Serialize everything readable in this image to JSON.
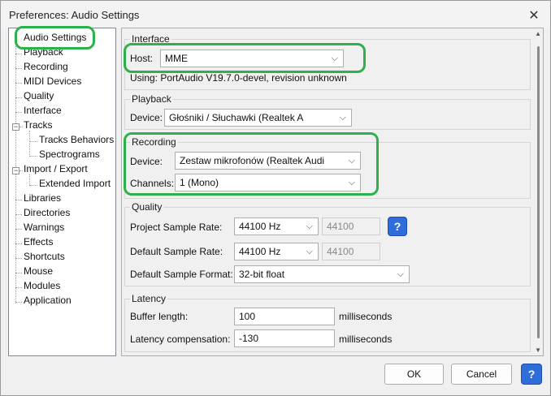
{
  "window": {
    "title": "Preferences: Audio Settings"
  },
  "tree": {
    "items": [
      {
        "label": "Audio Settings"
      },
      {
        "label": "Playback"
      },
      {
        "label": "Recording"
      },
      {
        "label": "MIDI Devices"
      },
      {
        "label": "Quality"
      },
      {
        "label": "Interface"
      },
      {
        "label": "Tracks"
      },
      {
        "label": "Tracks Behaviors"
      },
      {
        "label": "Spectrograms"
      },
      {
        "label": "Import / Export"
      },
      {
        "label": "Extended Import"
      },
      {
        "label": "Libraries"
      },
      {
        "label": "Directories"
      },
      {
        "label": "Warnings"
      },
      {
        "label": "Effects"
      },
      {
        "label": "Shortcuts"
      },
      {
        "label": "Mouse"
      },
      {
        "label": "Modules"
      },
      {
        "label": "Application"
      }
    ]
  },
  "interface": {
    "title": "Interface",
    "host_label": "Host:",
    "host_value": "MME",
    "using_text": "Using: PortAudio V19.7.0-devel, revision unknown"
  },
  "playback": {
    "title": "Playback",
    "device_label": "Device:",
    "device_value": "Głośniki / Słuchawki (Realtek A"
  },
  "recording": {
    "title": "Recording",
    "device_label": "Device:",
    "device_value": "Zestaw mikrofonów (Realtek Audi",
    "channels_label": "Channels:",
    "channels_value": "1 (Mono)"
  },
  "quality": {
    "title": "Quality",
    "project_rate_label": "Project Sample Rate:",
    "project_rate_value": "44100 Hz",
    "project_rate_text": "44100",
    "default_rate_label": "Default Sample Rate:",
    "default_rate_value": "44100 Hz",
    "default_rate_text": "44100",
    "default_format_label": "Default Sample Format:",
    "default_format_value": "32-bit float",
    "help_glyph": "?"
  },
  "latency": {
    "title": "Latency",
    "buffer_label": "Buffer length:",
    "buffer_value": "100",
    "buffer_unit": "milliseconds",
    "comp_label": "Latency compensation:",
    "comp_value": "-130",
    "comp_unit": "milliseconds"
  },
  "footer": {
    "ok_label": "OK",
    "cancel_label": "Cancel",
    "help_glyph": "?"
  },
  "icons": {
    "close": "close-icon",
    "chevron": "chevron-down-icon",
    "help": "help-icon",
    "collapse": "collapse-icon"
  },
  "colors": {
    "highlight": "#2bb24c",
    "help_button": "#2f6ddb"
  }
}
